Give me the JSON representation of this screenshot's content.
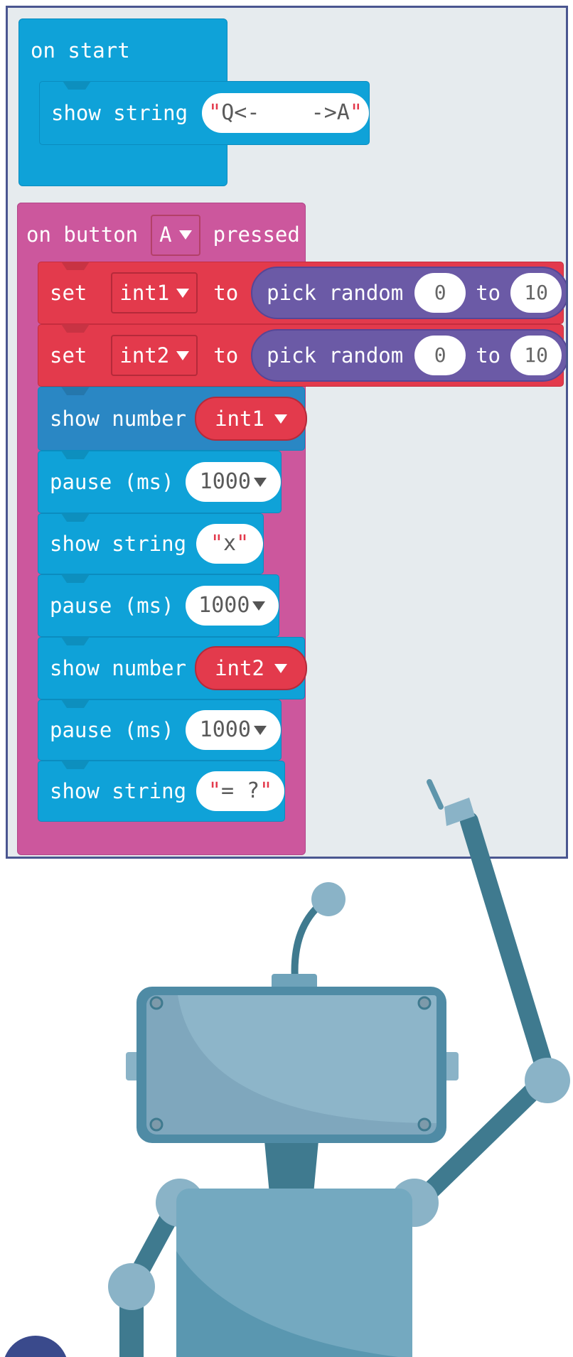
{
  "workspace": {
    "on_start": {
      "hat_label": "on start",
      "show_string_label": "show string",
      "show_string_value": "\"Q<-    ->A\""
    },
    "on_button": {
      "label_prefix": "on button",
      "button_value": "A",
      "label_suffix": "pressed",
      "statements": {
        "set1": {
          "set": "set",
          "var": "int1",
          "to": "to",
          "fn": "pick random",
          "min": "0",
          "to2": "to",
          "max": "10"
        },
        "set2": {
          "set": "set",
          "var": "int2",
          "to": "to",
          "fn": "pick random",
          "min": "0",
          "to2": "to",
          "max": "10"
        },
        "show_num1": {
          "label": "show number",
          "var": "int1"
        },
        "pause1": {
          "label": "pause (ms)",
          "value": "1000"
        },
        "show_str_x": {
          "label": "show string",
          "value": "\"x\""
        },
        "pause2": {
          "label": "pause (ms)",
          "value": "1000"
        },
        "show_num2": {
          "label": "show number",
          "var": "int2"
        },
        "pause3": {
          "label": "pause (ms)",
          "value": "1000"
        },
        "show_str_eq": {
          "label": "show string",
          "value": "\"= ?\""
        }
      }
    }
  },
  "colors": {
    "basic_blue": "#0fa2d8",
    "input_pink": "#cc579d",
    "variable_red": "#e33a4c",
    "math_purple": "#6b5aa6",
    "workspace_bg": "#e6ebee",
    "robot_primary": "#4f8ba5",
    "robot_light": "#8ab3c7"
  },
  "icons": [
    "dropdown-arrow-icon",
    "robot-illustration"
  ]
}
